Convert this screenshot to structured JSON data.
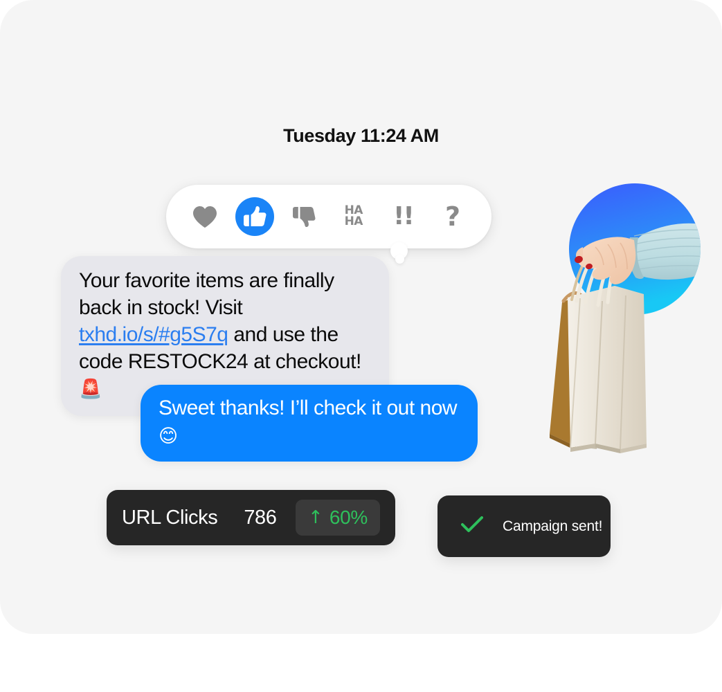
{
  "card": {
    "background_color": "#F5F5F5"
  },
  "conversation": {
    "timestamp": "Tuesday 11:24 AM",
    "reaction_bar": {
      "reactions": [
        {
          "name": "heart",
          "label": "Love",
          "selected": false
        },
        {
          "name": "thumbs-up",
          "label": "Like",
          "selected": true
        },
        {
          "name": "thumbs-down",
          "label": "Dislike",
          "selected": false
        },
        {
          "name": "haha",
          "label": "HA",
          "label2": "HA",
          "selected": false
        },
        {
          "name": "exclamation",
          "label": "!!",
          "selected": false
        },
        {
          "name": "question",
          "label": "?",
          "selected": false
        }
      ],
      "selected_color": "#1A84F7",
      "icon_color": "#8A8A8A"
    },
    "messages": [
      {
        "direction": "incoming",
        "bubble_color": "#E7E7EC",
        "text_color": "#0B0B0B",
        "link_color": "#2B7EF0",
        "parts": [
          {
            "type": "text",
            "value": "Your favorite items are finally back in stock! Visit "
          },
          {
            "type": "link",
            "value": "txhd.io/s/#g5S7q"
          },
          {
            "type": "text",
            "value": " and use the code RESTOCK24 at checkout! "
          },
          {
            "type": "emoji",
            "value": "🚨"
          }
        ],
        "plain_text": "Your favorite items are finally back in stock! Visit txhd.io/s/#g5S7q and use the code RESTOCK24 at checkout! 🚨"
      },
      {
        "direction": "outgoing",
        "bubble_color": "#0A84FF",
        "text_color": "#FFFFFF",
        "parts": [
          {
            "type": "text",
            "value": "Sweet thanks! I’ll check it out now "
          },
          {
            "type": "emoji",
            "value": "😊"
          }
        ],
        "plain_text": "Sweet thanks! I’ll check it out now 😊"
      }
    ]
  },
  "photo": {
    "name": "hand-holding-shopping-bags",
    "circle_gradient_from": "#3B5BFD",
    "circle_gradient_to": "#18C8F5",
    "sleeve_color": "#BFDDE2",
    "skin_color": "#F3CDB3",
    "nail_color": "#C01C22",
    "bag_kraft_color": "#C08A52",
    "bag_cream_color": "#E8E1D6"
  },
  "stat_card": {
    "label": "URL Clicks",
    "value": "786",
    "badge": {
      "arrow": "↑",
      "percent": "60%",
      "color": "#2EC05C"
    },
    "background_color": "#262626"
  },
  "toast": {
    "icon": "check-icon",
    "message": "Campaign sent!",
    "icon_color": "#2EC05C",
    "background_color": "#262626"
  }
}
